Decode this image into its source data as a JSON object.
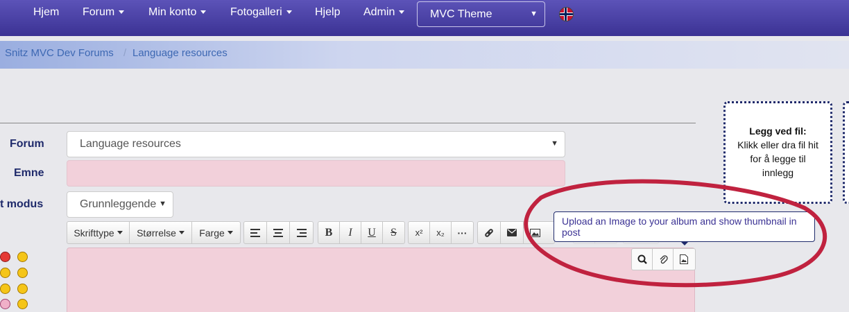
{
  "nav": {
    "items": [
      {
        "label": "Hjem",
        "dropdown": false
      },
      {
        "label": "Forum",
        "dropdown": true
      },
      {
        "label": "Min konto",
        "dropdown": true
      },
      {
        "label": "Fotogalleri",
        "dropdown": true
      },
      {
        "label": "Hjelp",
        "dropdown": false
      },
      {
        "label": "Admin",
        "dropdown": true
      }
    ],
    "theme_select": "MVC Theme",
    "language_flag": "norway-flag-icon"
  },
  "breadcrumb": [
    "Snitz MVC Dev Forums",
    "Language resources"
  ],
  "form": {
    "forum_label": "Forum",
    "forum_value": "Language resources",
    "subject_label": "Emne",
    "subject_value": "",
    "mode_label": "t modus",
    "mode_value": "Grunnleggende"
  },
  "toolbar": {
    "font_label": "Skrifttype",
    "size_label": "Størrelse",
    "color_label": "Farge",
    "bold": "B",
    "italic": "I",
    "underline": "U",
    "strike": "S",
    "superscript": "x²",
    "subscript": "x₂",
    "more": "···"
  },
  "tooltip": "Upload an Image to your album and show thumbnail in post",
  "dropzone": {
    "title": "Legg ved fil:",
    "text": "Klikk eller dra fil hit for å legge til innlegg"
  },
  "colors": {
    "nav_bg": "#3b3294",
    "label_color": "#1f2a6b",
    "required_field_bg": "#f2d0da",
    "annotation_circle": "#c0223f"
  }
}
